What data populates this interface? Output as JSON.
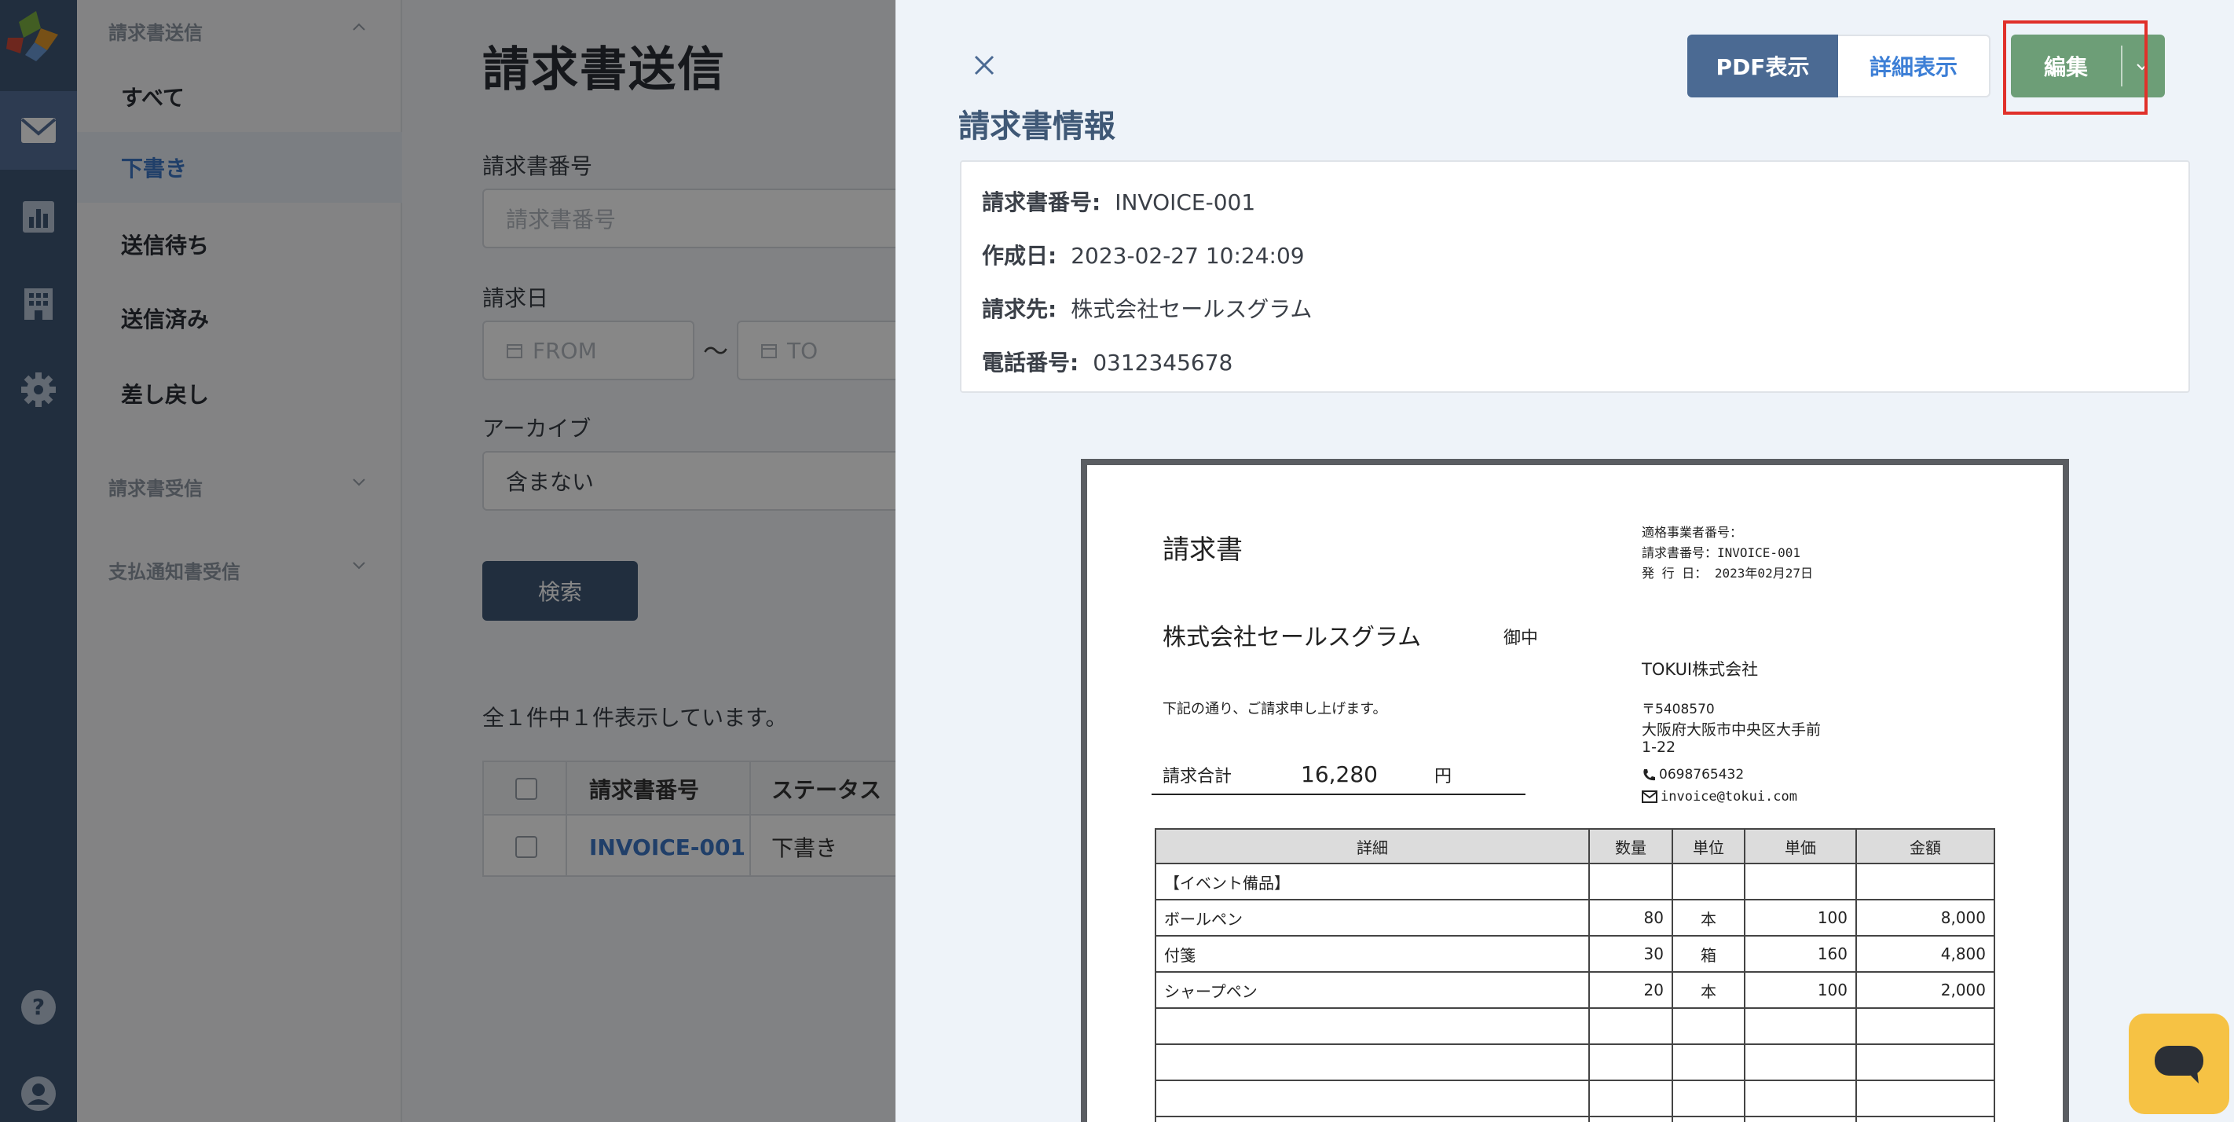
{
  "app": {
    "brand_colors": {
      "rail": "#3f5876",
      "accent": "#3d78c7",
      "edit": "#6d9e77",
      "highlight": "#e0302a",
      "chat": "#f6c244"
    }
  },
  "sidebar": {
    "group_send": "請求書送信",
    "items": [
      "すべて",
      "下書き",
      "送信待ち",
      "送信済み",
      "差し戻し"
    ],
    "active_index": 1,
    "group_receive": "請求書受信",
    "group_payment": "支払通知書受信"
  },
  "main": {
    "title": "請求書送信",
    "invoice_number_label": "請求書番号",
    "invoice_number_placeholder": "請求書番号",
    "invoice_date_label": "請求日",
    "date_from_placeholder": "FROM",
    "date_to_placeholder": "TO",
    "date_separator": "〜",
    "archive_label": "アーカイブ",
    "archive_value": "含まない",
    "search_button": "検索",
    "result_count": "全１件中１件表示しています。",
    "table": {
      "headers": [
        "請求書番号",
        "ステータス"
      ],
      "rows": [
        {
          "number": "INVOICE-001",
          "status": "下書き"
        }
      ]
    }
  },
  "drawer": {
    "title": "請求書情報",
    "pdf_button": "PDF表示",
    "detail_button": "詳細表示",
    "edit_button": "編集",
    "info": {
      "number_label": "請求書番号:",
      "number_value": "INVOICE-001",
      "created_label": "作成日:",
      "created_value": "2023-02-27 10:24:09",
      "client_label": "請求先:",
      "client_value": "株式会社セールスグラム",
      "phone_label": "電話番号:",
      "phone_value": "0312345678"
    }
  },
  "invoice": {
    "title": "請求書",
    "meta_reg": "適格事業者番号：",
    "meta_number": "請求書番号：INVOICE-001",
    "meta_date": "発 行 日： 2023年02月27日",
    "client": "株式会社セールスグラム",
    "honorific": "御中",
    "seller_name": "TOKUI株式会社",
    "seller_zip": "〒5408570",
    "seller_addr1": "大阪府大阪市中央区大手前",
    "seller_addr2": "1-22",
    "seller_phone": "0698765432",
    "seller_email": "invoice@tokui.com",
    "intro": "下記の通り、ご請求申し上げます。",
    "total_label": "請求合計",
    "total_value": "16,280",
    "total_unit": "円",
    "table_headers": [
      "詳細",
      "数量",
      "単位",
      "単価",
      "金額"
    ],
    "section": "【イベント備品】",
    "lines": [
      {
        "name": "ボールペン",
        "qty": "80",
        "unit": "本",
        "price": "100",
        "amount": "8,000"
      },
      {
        "name": "付箋",
        "qty": "30",
        "unit": "箱",
        "price": "160",
        "amount": "4,800"
      },
      {
        "name": "シャープペン",
        "qty": "20",
        "unit": "本",
        "price": "100",
        "amount": "2,000"
      }
    ]
  },
  "icons": [
    "logo-icon",
    "mail-icon",
    "chart-icon",
    "building-icon",
    "gear-icon",
    "help-icon",
    "user-icon",
    "close-icon",
    "chevron-down-icon",
    "calendar-icon",
    "phone-icon",
    "envelope-icon",
    "chat-icon"
  ]
}
